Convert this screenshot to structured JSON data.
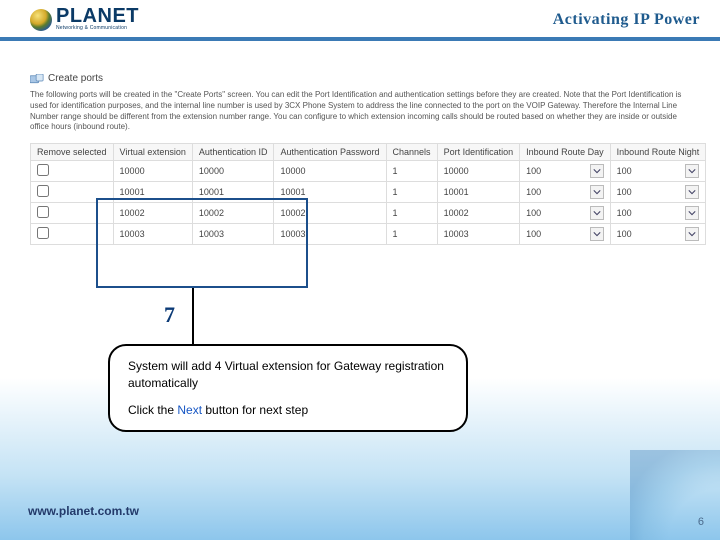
{
  "header": {
    "brand": "PLANET",
    "brand_sub": "Networking & Communication",
    "tagline": "Activating IP Power"
  },
  "section": {
    "title": "Create ports",
    "intro": "The following ports will be created in the \"Create Ports\" screen. You can edit the Port Identification and authentication settings before they are created. Note that the Port Identification is used for identification purposes, and the internal line number is used by 3CX Phone System to address the line connected to the port on the VOIP Gateway. Therefore the Internal Line Number range should be different from the extension number range. You can configure to which extension incoming calls should be routed based on whether they are inside or outside office hours (inbound route)."
  },
  "table": {
    "columns": [
      "Remove selected",
      "Virtual extension",
      "Authentication ID",
      "Authentication Password",
      "Channels",
      "Port Identification",
      "Inbound Route Day",
      "Inbound Route Night"
    ],
    "rows": [
      {
        "ve": "10000",
        "aid": "10000",
        "apw": "10000",
        "ch": "1",
        "pid": "10000",
        "day": "100",
        "night": "100"
      },
      {
        "ve": "10001",
        "aid": "10001",
        "apw": "10001",
        "ch": "1",
        "pid": "10001",
        "day": "100",
        "night": "100"
      },
      {
        "ve": "10002",
        "aid": "10002",
        "apw": "10002",
        "ch": "1",
        "pid": "10002",
        "day": "100",
        "night": "100"
      },
      {
        "ve": "10003",
        "aid": "10003",
        "apw": "10003",
        "ch": "1",
        "pid": "10003",
        "day": "100",
        "night": "100"
      }
    ]
  },
  "step": {
    "number": "7"
  },
  "callout": {
    "line1": "System will add 4 Virtual extension for Gateway registration automatically",
    "line2a": "Click the ",
    "line2_next": "Next",
    "line2b": " button for next step"
  },
  "footer": {
    "url": "www.planet.com.tw",
    "page": "6"
  }
}
